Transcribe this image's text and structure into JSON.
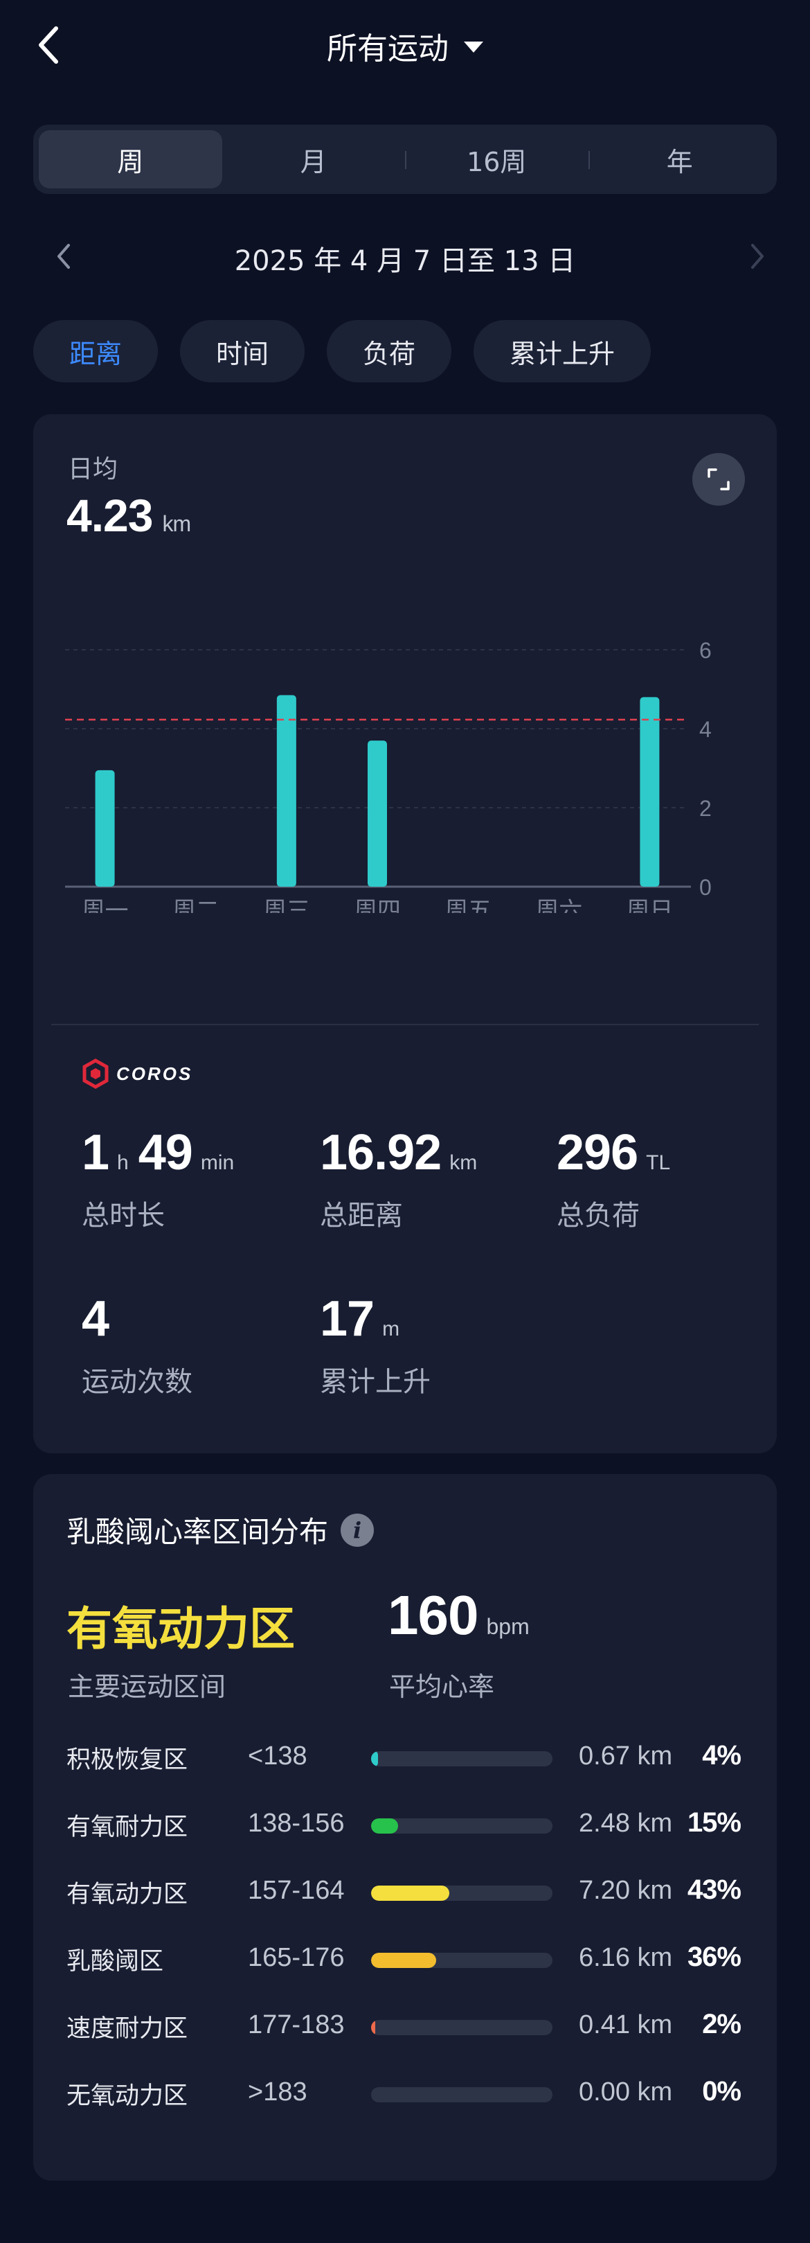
{
  "header": {
    "title": "所有运动"
  },
  "period_tabs": [
    {
      "label": "周",
      "active": true
    },
    {
      "label": "月",
      "active": false
    },
    {
      "label": "16周",
      "active": false
    },
    {
      "label": "年",
      "active": false
    }
  ],
  "date_range": "2025 年 4 月 7 日至 13 日",
  "metric_chips": [
    {
      "label": "距离",
      "active": true
    },
    {
      "label": "时间",
      "active": false
    },
    {
      "label": "负荷",
      "active": false
    },
    {
      "label": "累计上升",
      "active": false
    }
  ],
  "summary": {
    "avg_label": "日均",
    "avg_value": "4.23",
    "avg_unit": "km"
  },
  "chart_data": {
    "type": "bar",
    "categories": [
      "周一",
      "周二",
      "周三",
      "周四",
      "周五",
      "周六",
      "周日"
    ],
    "values": [
      2.95,
      0,
      4.85,
      3.7,
      0,
      0,
      4.8
    ],
    "yticks": [
      "6",
      "4",
      "2",
      "0"
    ],
    "ylim": [
      0,
      6
    ],
    "average_line": 4.23,
    "bar_color": "#2fcbcb",
    "average_line_color": "#e0414f",
    "grid": true
  },
  "brand": {
    "name": "COROS",
    "color": "#e0283a"
  },
  "stats": {
    "duration": {
      "hours": "1",
      "h_unit": "h",
      "minutes": "49",
      "min_unit": "min",
      "label": "总时长"
    },
    "distance": {
      "value": "16.92",
      "unit": "km",
      "label": "总距离"
    },
    "load": {
      "value": "296",
      "unit": "TL",
      "label": "总负荷"
    },
    "count": {
      "value": "4",
      "label": "运动次数"
    },
    "ascent": {
      "value": "17",
      "unit": "m",
      "label": "累计上升"
    }
  },
  "zones": {
    "title": "乳酸阈心率区间分布",
    "main_zone": "有氧动力区",
    "main_zone_label": "主要运动区间",
    "avg_hr": "160",
    "avg_hr_unit": "bpm",
    "avg_hr_label": "平均心率",
    "rows": [
      {
        "name": "积极恢复区",
        "range": "<138",
        "distance": "0.67 km",
        "pct": "4%",
        "fraction": 0.04,
        "color": "#2fcbcb"
      },
      {
        "name": "有氧耐力区",
        "range": "138-156",
        "distance": "2.48 km",
        "pct": "15%",
        "fraction": 0.15,
        "color": "#27c24c"
      },
      {
        "name": "有氧动力区",
        "range": "157-164",
        "distance": "7.20 km",
        "pct": "43%",
        "fraction": 0.43,
        "color": "#f4df3e"
      },
      {
        "name": "乳酸阈区",
        "range": "165-176",
        "distance": "6.16 km",
        "pct": "36%",
        "fraction": 0.36,
        "color": "#f3bd2e"
      },
      {
        "name": "速度耐力区",
        "range": "177-183",
        "distance": "0.41 km",
        "pct": "2%",
        "fraction": 0.02,
        "color": "#ee6a4a"
      },
      {
        "name": "无氧动力区",
        "range": ">183",
        "distance": "0.00 km",
        "pct": "0%",
        "fraction": 0.0,
        "color": "#d83a3a"
      }
    ]
  }
}
